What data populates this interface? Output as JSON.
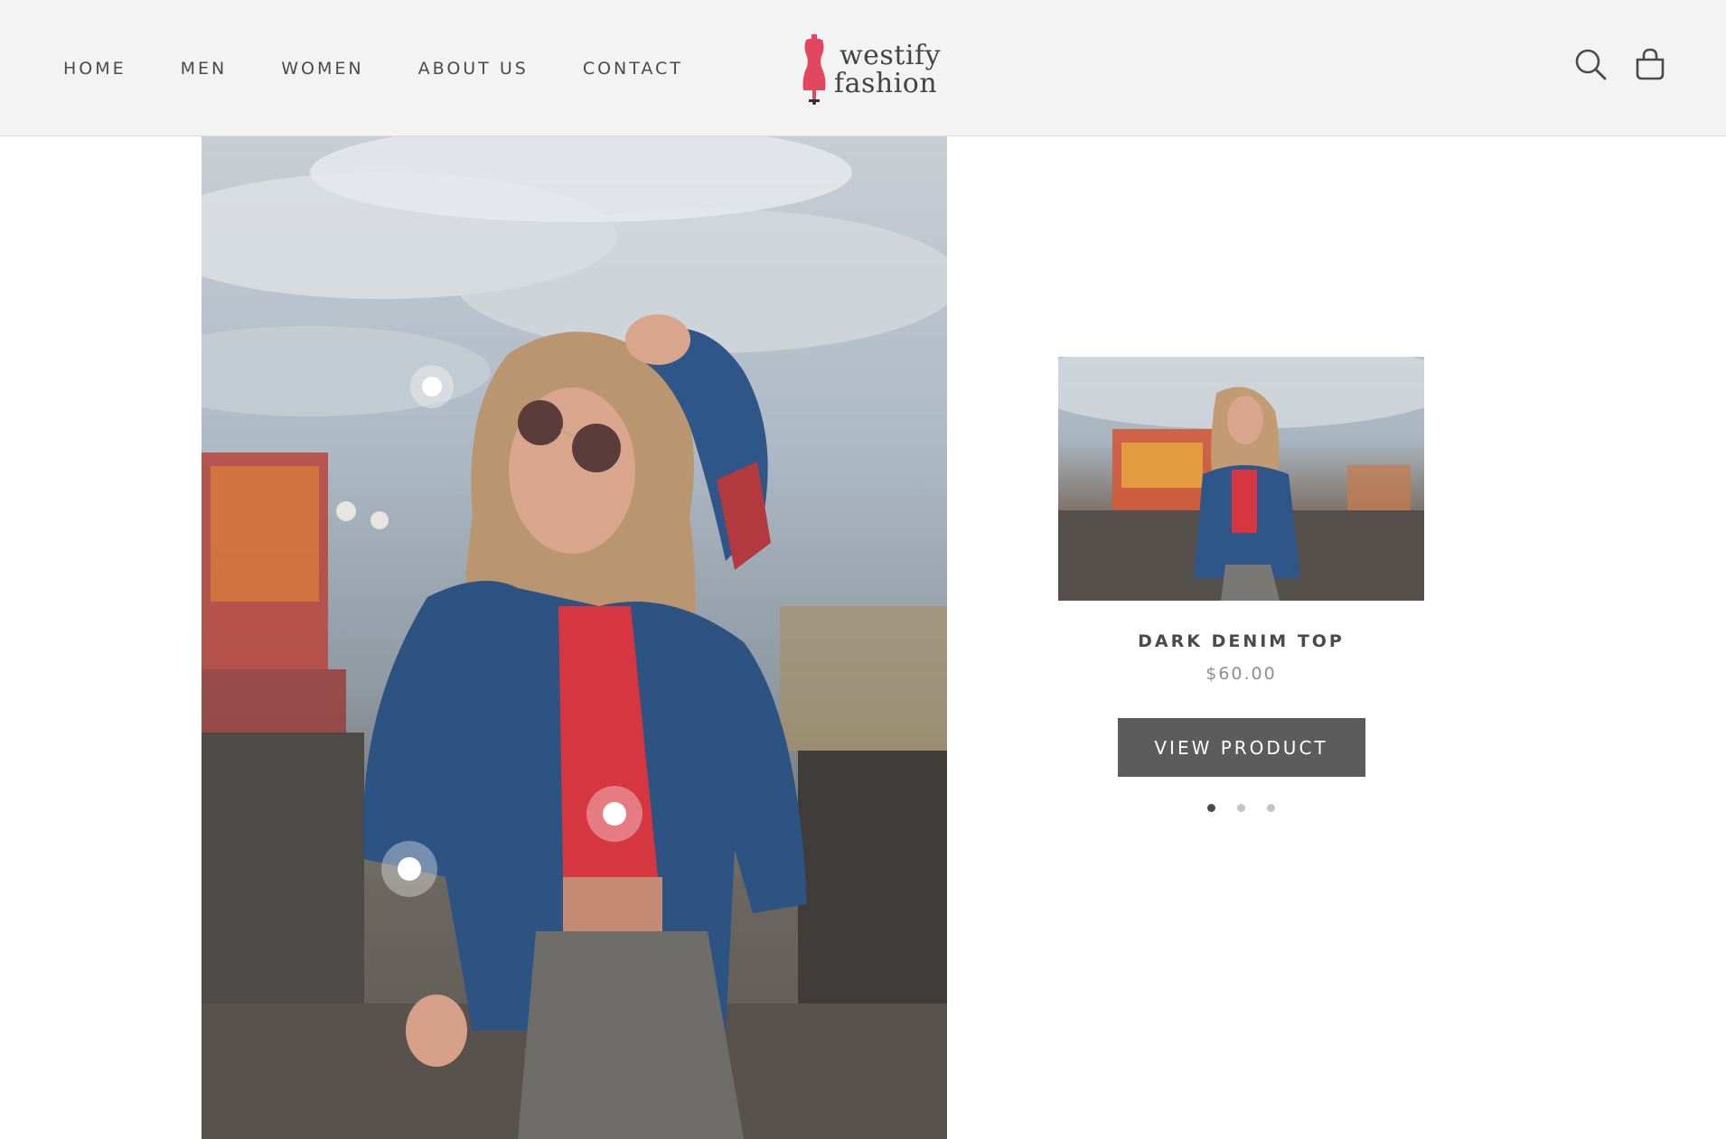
{
  "header": {
    "nav": [
      {
        "label": "HOME"
      },
      {
        "label": "MEN"
      },
      {
        "label": "WOMEN"
      },
      {
        "label": "ABOUT US"
      },
      {
        "label": "CONTACT"
      }
    ],
    "logo": {
      "line1": "westify",
      "line2": "fashion",
      "icon": "dress-form-icon",
      "color": "#e2475f"
    },
    "icons": [
      "search-icon",
      "shopping-bag-icon"
    ]
  },
  "lookbook": {
    "image": "woman-denim-jacket-photo",
    "hotspots": [
      "hotspot-sunglasses",
      "hotspot-red-top",
      "hotspot-denim-jacket"
    ]
  },
  "product": {
    "title": "DARK DENIM TOP",
    "price": "$60.00",
    "button_label": "VIEW PRODUCT",
    "carousel_dots": 3,
    "active_dot": 1
  },
  "colors": {
    "header_bg": "#f3f3f3",
    "button_bg": "#5c5c5c",
    "brand_pink": "#e2475f"
  }
}
